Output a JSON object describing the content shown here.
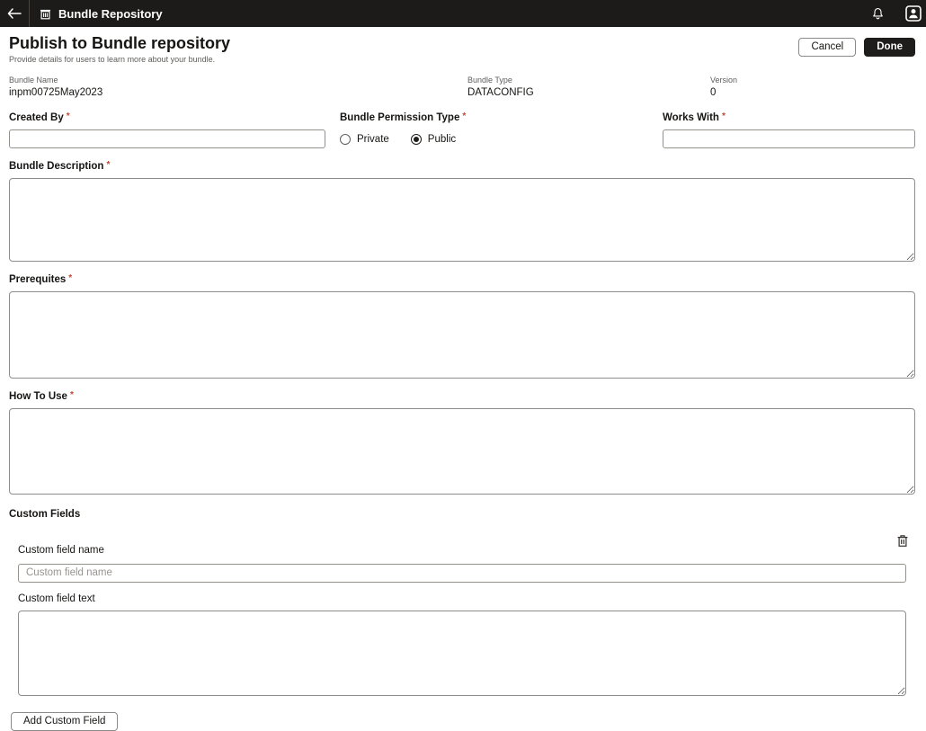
{
  "topbar": {
    "title": "Bundle Repository"
  },
  "header": {
    "title": "Publish to Bundle repository",
    "subtitle": "Provide details for users to learn more about your bundle.",
    "cancel_label": "Cancel",
    "done_label": "Done"
  },
  "required_mark": "*",
  "readonly_fields": {
    "bundle_name": {
      "label": "Bundle Name",
      "value": "inpm00725May2023"
    },
    "bundle_type": {
      "label": "Bundle Type",
      "value": "DATACONFIG"
    },
    "version": {
      "label": "Version",
      "value": "0"
    }
  },
  "form": {
    "created_by": {
      "label": "Created By",
      "value": ""
    },
    "permission": {
      "label": "Bundle Permission Type",
      "options": [
        {
          "label": "Private",
          "selected": false
        },
        {
          "label": "Public",
          "selected": true
        }
      ]
    },
    "works_with": {
      "label": "Works With",
      "value": ""
    },
    "bundle_description": {
      "label": "Bundle Description",
      "value": ""
    },
    "prerequites": {
      "label": "Prerequites",
      "value": ""
    },
    "how_to_use": {
      "label": "How To Use",
      "value": ""
    }
  },
  "custom_fields": {
    "section_title": "Custom Fields",
    "name_label": "Custom field name",
    "name_placeholder": "Custom field name",
    "name_value": "",
    "text_label": "Custom field text",
    "text_value": "",
    "add_button_label": "Add Custom Field"
  },
  "icons": {
    "back": "back-arrow",
    "app": "bundle-repository-building",
    "notifications": "bell",
    "user": "person-avatar",
    "delete_custom_field": "trash"
  },
  "colors": {
    "topbar_bg": "#1c1b1a",
    "primary_button_bg": "#1f1d1b",
    "required_asterisk": "#c74634",
    "input_border": "#95918c",
    "muted_label": "#5f5e5c"
  }
}
